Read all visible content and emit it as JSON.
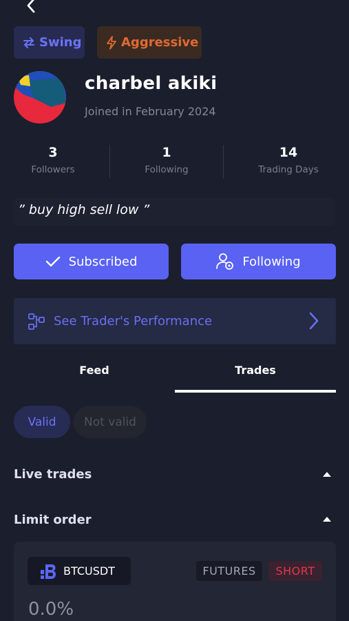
{
  "header": {
    "back_icon": "chevron-left-icon"
  },
  "tags": [
    {
      "label": "Swing",
      "icon": "swap-arrows-icon",
      "color": "#6b73f5"
    },
    {
      "label": "Aggressive",
      "icon": "lightning-icon",
      "color": "#e06a32"
    }
  ],
  "profile": {
    "name": "charbel akiki",
    "joined": "Joined in February 2024",
    "bio": "” buy high sell low ”"
  },
  "stats": [
    {
      "value": "3",
      "label": "Followers"
    },
    {
      "value": "1",
      "label": "Following"
    },
    {
      "value": "14",
      "label": "Trading Days"
    }
  ],
  "actions": {
    "subscribed_label": "Subscribed",
    "following_label": "Following"
  },
  "performance": {
    "label": "See Trader's Performance"
  },
  "tabs": [
    {
      "label": "Feed",
      "active": false
    },
    {
      "label": "Trades",
      "active": true
    }
  ],
  "filters": [
    {
      "label": "Valid",
      "active": true
    },
    {
      "label": "Not valid",
      "active": false
    }
  ],
  "sections": {
    "live_trades": "Live trades",
    "limit_order": "Limit order"
  },
  "trade_card": {
    "pair": "BTCUSDT",
    "market": "FUTURES",
    "direction": "SHORT",
    "percent": "0.0%"
  },
  "colors": {
    "background": "#1b1e2c",
    "accent": "#5962f2",
    "short": "#e0384e"
  }
}
